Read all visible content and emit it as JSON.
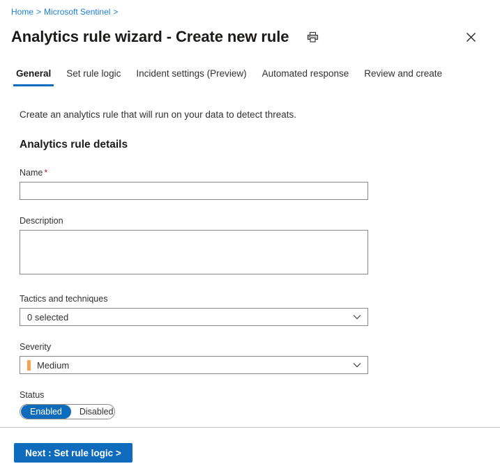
{
  "breadcrumb": {
    "items": [
      {
        "label": "Home"
      },
      {
        "label": "Microsoft Sentinel"
      }
    ],
    "separator": ">",
    "trailing_separator": ">"
  },
  "header": {
    "title": "Analytics rule wizard - Create new rule",
    "print_icon": "print-icon",
    "close_icon": "close-icon"
  },
  "tabs": [
    {
      "label": "General",
      "active": true
    },
    {
      "label": "Set rule logic",
      "active": false
    },
    {
      "label": "Incident settings (Preview)",
      "active": false
    },
    {
      "label": "Automated response",
      "active": false
    },
    {
      "label": "Review and create",
      "active": false
    }
  ],
  "main": {
    "intro": "Create an analytics rule that will run on your data to detect threats.",
    "section_title": "Analytics rule details",
    "fields": {
      "name": {
        "label": "Name",
        "required_marker": "*",
        "value": "",
        "placeholder": ""
      },
      "description": {
        "label": "Description",
        "value": "",
        "placeholder": ""
      },
      "tactics": {
        "label": "Tactics and techniques",
        "value": "0 selected",
        "chevron_icon": "chevron-down-icon"
      },
      "severity": {
        "label": "Severity",
        "value": "Medium",
        "swatch_color": "#f7a44d",
        "chevron_icon": "chevron-down-icon"
      },
      "status": {
        "label": "Status",
        "enabled_label": "Enabled",
        "disabled_label": "Disabled",
        "selected": "Enabled"
      }
    }
  },
  "footer": {
    "next_button": "Next : Set rule logic >"
  },
  "colors": {
    "accent": "#0f6cbd",
    "link": "#1a7fd4",
    "required": "#a4262c",
    "severity_medium": "#f7a44d",
    "border": "#8a8886",
    "text": "#323130"
  }
}
